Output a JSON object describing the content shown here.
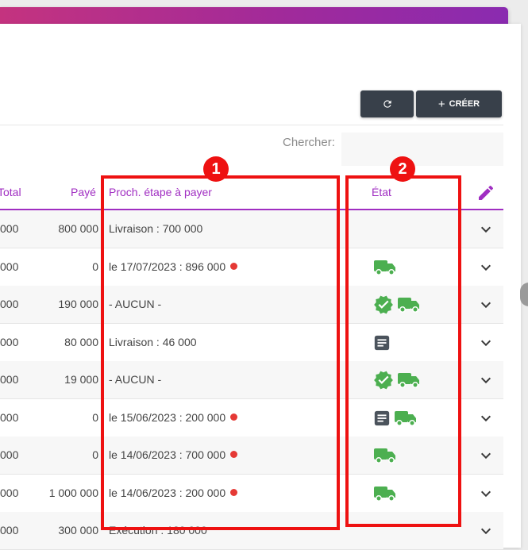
{
  "toolbar": {
    "refresh_icon": "refresh-icon",
    "create_label": "CRÉER",
    "create_icon": "plus-icon"
  },
  "search": {
    "label": "Chercher:",
    "value": ""
  },
  "table": {
    "headers": {
      "total": "Total",
      "paye": "Payé",
      "next": "Proch. étape à payer",
      "etat": "État"
    },
    "rows": [
      {
        "total": "000",
        "paye": "800 000",
        "next": "Livraison : 700 000",
        "overdue": false,
        "icons": []
      },
      {
        "total": "000",
        "paye": "0",
        "next": "le 17/07/2023 : 896 000",
        "overdue": true,
        "icons": [
          "truck-icon"
        ]
      },
      {
        "total": "000",
        "paye": "190 000",
        "next": "- AUCUN -",
        "overdue": false,
        "icons": [
          "verified-icon",
          "truck-icon"
        ]
      },
      {
        "total": "000",
        "paye": "80 000",
        "next": "Livraison : 46 000",
        "overdue": false,
        "icons": [
          "document-icon"
        ]
      },
      {
        "total": "000",
        "paye": "19 000",
        "next": "- AUCUN -",
        "overdue": false,
        "icons": [
          "verified-icon",
          "truck-icon"
        ]
      },
      {
        "total": "000",
        "paye": "0",
        "next": "le 15/06/2023 : 200 000",
        "overdue": true,
        "icons": [
          "document-icon",
          "truck-icon"
        ]
      },
      {
        "total": "000",
        "paye": "0",
        "next": "le 14/06/2023 : 700 000",
        "overdue": true,
        "icons": [
          "truck-icon"
        ]
      },
      {
        "total": "000",
        "paye": "1 000 000",
        "next": "le 14/06/2023 : 200 000",
        "overdue": true,
        "icons": [
          "truck-icon"
        ]
      },
      {
        "total": "000",
        "paye": "300 000",
        "next": "Exécution : 180 000",
        "overdue": false,
        "icons": []
      }
    ]
  },
  "annotations": {
    "badge1": "1",
    "badge2": "2"
  },
  "colors": {
    "accent": "#a02ec2",
    "success": "#4caf50",
    "overdue": "#e53935",
    "annotation": "#ee1111",
    "dark_button": "#38404a"
  }
}
